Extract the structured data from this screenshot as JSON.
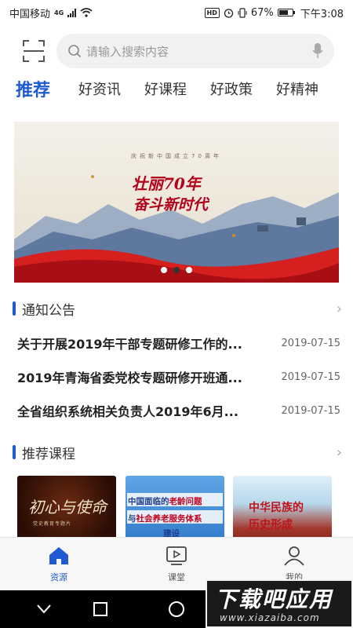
{
  "status_bar": {
    "carrier": "中国移动",
    "network": "4G",
    "battery": "67%",
    "battery_level": 0.67,
    "time": "下午3:08"
  },
  "search": {
    "placeholder": "请输入搜索内容"
  },
  "tabs": [
    {
      "label": "推荐",
      "active": true
    },
    {
      "label": "好资讯",
      "active": false
    },
    {
      "label": "好课程",
      "active": false
    },
    {
      "label": "好政策",
      "active": false
    },
    {
      "label": "好精神",
      "active": false
    }
  ],
  "banner": {
    "small_text": "庆祝新中国成立70周年",
    "title_line1": "壮丽70年",
    "title_line2": "奋斗新时代",
    "active_slide": 1,
    "slide_count": 3
  },
  "notices": {
    "title": "通知公告",
    "items": [
      {
        "title": "关于开展2019年干部专题研修工作的...",
        "date": "2019-07-15"
      },
      {
        "title": "2019年青海省委党校专题研修开班通...",
        "date": "2019-07-15"
      },
      {
        "title": "全省组织系统相关负责人2019年6月...",
        "date": "2019-07-15"
      }
    ]
  },
  "courses": {
    "title": "推荐课程",
    "items": [
      {
        "title": "初心与使命",
        "subtitle": "党史教育专题片"
      },
      {
        "title_part1": "中国面临的",
        "title_hl": "老龄问题",
        "title_part2": "与",
        "title_hl2": "社会养老服务体系",
        "title_part3": "建设"
      },
      {
        "title_line1": "中华民族的",
        "title_line2": "历史形成"
      }
    ]
  },
  "bottom_nav": [
    {
      "label": "资源",
      "icon": "home-icon",
      "active": true
    },
    {
      "label": "课堂",
      "icon": "play-icon",
      "active": false
    },
    {
      "label": "我的",
      "icon": "user-icon",
      "active": false
    }
  ],
  "watermark": {
    "line1": "下载吧应用",
    "line2": "www.xiazaiba.com"
  },
  "colors": {
    "accent": "#1e5bd0",
    "banner_red": "#b3001b"
  }
}
